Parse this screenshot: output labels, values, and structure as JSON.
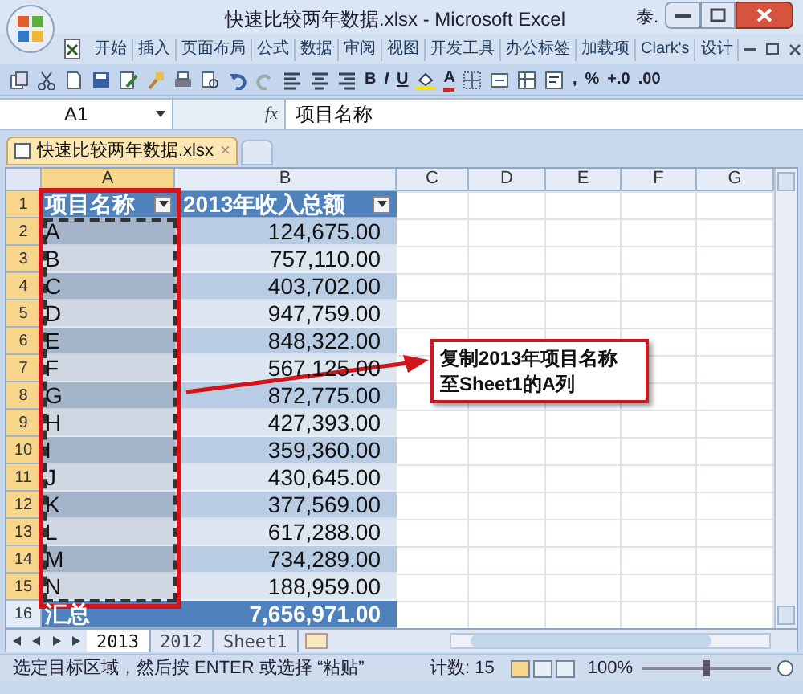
{
  "window": {
    "title": "快速比较两年数据.xlsx - Microsoft Excel",
    "extra": "泰."
  },
  "ribbon_tabs": [
    "开始",
    "插入",
    "页面布局",
    "公式",
    "数据",
    "审阅",
    "视图",
    "开发工具",
    "办公标签",
    "加载项",
    "Clark's",
    "设计"
  ],
  "toolbar": [
    {
      "kind": "copy"
    },
    {
      "kind": "cut"
    },
    {
      "kind": "new"
    },
    {
      "kind": "save"
    },
    {
      "kind": "edit"
    },
    {
      "kind": "brush"
    },
    {
      "kind": "print"
    },
    {
      "kind": "preview"
    },
    {
      "kind": "undo"
    },
    {
      "kind": "redo"
    },
    {
      "kind": "align-left"
    },
    {
      "kind": "align-center"
    },
    {
      "kind": "align-right"
    },
    {
      "kind": "text",
      "label": "B"
    },
    {
      "kind": "text",
      "label": "I"
    },
    {
      "kind": "text",
      "label": "U"
    },
    {
      "kind": "fill"
    },
    {
      "kind": "text",
      "label": "A"
    },
    {
      "kind": "border"
    },
    {
      "kind": "merge"
    },
    {
      "kind": "grid"
    },
    {
      "kind": "wrap"
    },
    {
      "kind": "text",
      "label": ","
    },
    {
      "kind": "text",
      "label": "%"
    },
    {
      "kind": "text",
      "label": "+.0"
    },
    {
      "kind": "text",
      "label": ".00"
    }
  ],
  "formula_bar": {
    "name_box": "A1",
    "fx": "fx",
    "value": "项目名称"
  },
  "workbook_tab": {
    "label": "快速比较两年数据.xlsx",
    "close": "×"
  },
  "columns": [
    {
      "label": "A",
      "selected": true
    },
    {
      "label": "B",
      "selected": false
    },
    {
      "label": "C",
      "selected": false
    },
    {
      "label": "D",
      "selected": false
    },
    {
      "label": "E",
      "selected": false
    },
    {
      "label": "F",
      "selected": false
    },
    {
      "label": "G",
      "selected": false
    }
  ],
  "rows": [
    {
      "num": "1",
      "kind": "header",
      "selected": true,
      "a": "项目名称",
      "b": "2013年收入总额"
    },
    {
      "num": "2",
      "kind": "data",
      "selected": true,
      "a": "A",
      "b": "124,675.00"
    },
    {
      "num": "3",
      "kind": "data",
      "selected": true,
      "a": "B",
      "b": "757,110.00"
    },
    {
      "num": "4",
      "kind": "data",
      "selected": true,
      "a": "C",
      "b": "403,702.00"
    },
    {
      "num": "5",
      "kind": "data",
      "selected": true,
      "a": "D",
      "b": "947,759.00"
    },
    {
      "num": "6",
      "kind": "data",
      "selected": true,
      "a": "E",
      "b": "848,322.00"
    },
    {
      "num": "7",
      "kind": "data",
      "selected": true,
      "a": "F",
      "b": "567,125.00"
    },
    {
      "num": "8",
      "kind": "data",
      "selected": true,
      "a": "G",
      "b": "872,775.00"
    },
    {
      "num": "9",
      "kind": "data",
      "selected": true,
      "a": "H",
      "b": "427,393.00"
    },
    {
      "num": "10",
      "kind": "data",
      "selected": true,
      "a": "I",
      "b": "359,360.00"
    },
    {
      "num": "11",
      "kind": "data",
      "selected": true,
      "a": "J",
      "b": "430,645.00"
    },
    {
      "num": "12",
      "kind": "data",
      "selected": true,
      "a": "K",
      "b": "377,569.00"
    },
    {
      "num": "13",
      "kind": "data",
      "selected": true,
      "a": "L",
      "b": "617,288.00"
    },
    {
      "num": "14",
      "kind": "data",
      "selected": true,
      "a": "M",
      "b": "734,289.00"
    },
    {
      "num": "15",
      "kind": "data",
      "selected": true,
      "a": "N",
      "b": "188,959.00"
    },
    {
      "num": "16",
      "kind": "total",
      "selected": false,
      "a": "汇总",
      "b": "7,656,971.00"
    }
  ],
  "callout": {
    "lines": [
      "复制2013年项目名称",
      "至Sheet1的A列"
    ]
  },
  "sheet_tabs": [
    {
      "label": "2013",
      "selected": true
    },
    {
      "label": "2012",
      "selected": false
    },
    {
      "label": "Sheet1",
      "selected": false
    }
  ],
  "status_bar": {
    "message": "选定目标区域，然后按 ENTER 或选择 “粘贴”",
    "count": "计数: 15",
    "zoom": "100%",
    "zoom_slider": {
      "level": 0.5
    }
  }
}
